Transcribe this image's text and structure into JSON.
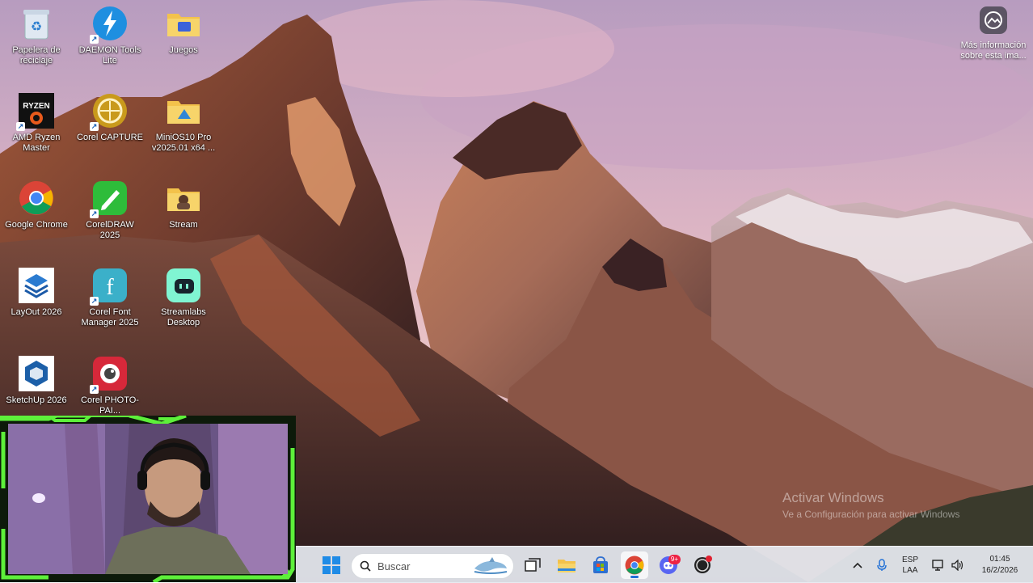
{
  "desktop": {
    "icons": [
      {
        "label": "Papelera de reciclaje",
        "icon": "recycle-bin-icon"
      },
      {
        "label": "DAEMON Tools Lite",
        "icon": "daemon-tools-icon"
      },
      {
        "label": "Juegos",
        "icon": "folder-icon"
      },
      {
        "label": "AMD Ryzen Master",
        "icon": "ryzen-master-icon"
      },
      {
        "label": "Corel CAPTURE",
        "icon": "corel-capture-icon"
      },
      {
        "label": "MiniOS10 Pro v2025.01 x64 ...",
        "icon": "folder-icon"
      },
      {
        "label": "Google Chrome",
        "icon": "chrome-icon"
      },
      {
        "label": "CorelDRAW 2025",
        "icon": "coreldraw-icon"
      },
      {
        "label": "Stream",
        "icon": "folder-icon"
      },
      {
        "label": "LayOut 2026",
        "icon": "layout-icon"
      },
      {
        "label": "Corel Font Manager 2025",
        "icon": "corel-font-manager-icon"
      },
      {
        "label": "Streamlabs Desktop",
        "icon": "streamlabs-icon"
      },
      {
        "label": "SketchUp 2026",
        "icon": "sketchup-icon"
      },
      {
        "label": "Corel PHOTO-PAI...",
        "icon": "corel-photo-paint-icon"
      }
    ],
    "info_widget": {
      "label": "Más información sobre esta ima..."
    },
    "activation": {
      "title": "Activar Windows",
      "subtitle": "Ve a Configuración para activar Windows"
    }
  },
  "taskbar": {
    "search": {
      "placeholder": "Buscar"
    },
    "discord_badge": "9+",
    "tray": {
      "language": "ESP",
      "layout": "LAA",
      "time": "01:45",
      "date": "16/2/2026"
    }
  },
  "colors": {
    "taskbar_bg": "#e6eaf0",
    "accent": "#1f6fd6",
    "webcam_frame_green": "#5df03a"
  }
}
